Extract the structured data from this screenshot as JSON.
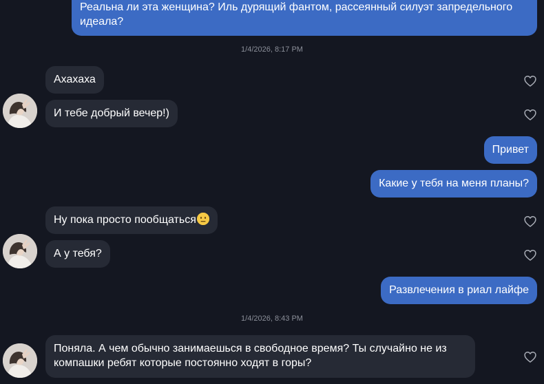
{
  "messages": {
    "m1": {
      "line1": "Реальна ли эта женщина? Иль дурящий фантом, рассеянный силуэт запредельного",
      "line2": "идеала?"
    },
    "ts1": "1/4/2026, 8:17 PM",
    "m2": "Ахахаха",
    "m3": "И тебе добрый вечер!)",
    "m4": "Привет",
    "m5": "Какие у тебя на меня планы?",
    "m6": "Ну пока просто пообщаться",
    "m6_emoji": "😐",
    "m7": "А у тебя?",
    "m8": "Развлечения в риал лайфе",
    "ts2": "1/4/2026, 8:43 PM",
    "m9": {
      "line1": "Поняла. А чем обычно занимаешься в свободное время? Ты случайно не из",
      "line2": "компашки ребят которые постоянно ходят в горы?"
    }
  },
  "colors": {
    "background": "#141721",
    "incoming_bubble": "#262a35",
    "outgoing_bubble": "#3c6bc4",
    "timestamp_text": "#8b8f99",
    "heart_outline": "#a9adb6"
  },
  "icons": {
    "like": "heart-outline-icon",
    "avatar": "contact-avatar"
  }
}
